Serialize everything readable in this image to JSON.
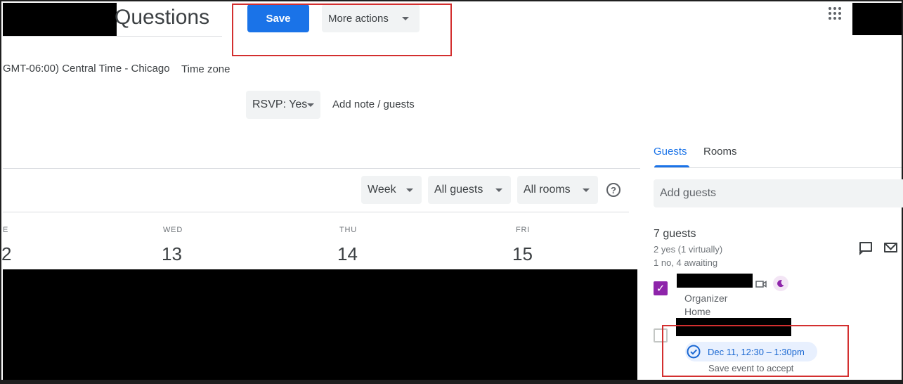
{
  "header": {
    "title": "Questions",
    "save_label": "Save",
    "more_actions_label": "More actions"
  },
  "timezone": {
    "value": "GMT-06:00) Central Time - Chicago",
    "link_label": "Time zone"
  },
  "rsvp": {
    "label": "RSVP: Yes",
    "add_note_label": "Add note / guests"
  },
  "toolbar": {
    "view_label": "Week",
    "guests_filter_label": "All guests",
    "rooms_filter_label": "All rooms",
    "help_glyph": "?"
  },
  "days": [
    {
      "name": "E",
      "number": "2"
    },
    {
      "name": "WED",
      "number": "13"
    },
    {
      "name": "THU",
      "number": "14"
    },
    {
      "name": "FRI",
      "number": "15"
    }
  ],
  "side_panel": {
    "tabs": [
      {
        "label": "Guests",
        "active": true
      },
      {
        "label": "Rooms",
        "active": false
      }
    ],
    "add_guests_placeholder": "Add guests",
    "guest_count": "7 guests",
    "yes_summary": "2 yes (1 virtually)",
    "other_summary": "1 no, 4 awaiting",
    "organizer": {
      "role": "Organizer",
      "location": "Home",
      "checked": true
    },
    "proposal": {
      "time": "Dec 11, 12:30 – 1:30pm",
      "note": "Save event to accept",
      "checked": false
    }
  },
  "colors": {
    "primary": "#1a73e8",
    "guest_check": "#8e24aa",
    "annotation": "#d32f2f",
    "redaction": "#000000"
  },
  "icons": {
    "apps": "apps-grid-icon",
    "help": "help-circle-icon",
    "chat": "chat-icon",
    "mail": "mail-icon",
    "video": "video-icon",
    "moon": "moon-icon",
    "time_check": "check-circle-icon"
  }
}
